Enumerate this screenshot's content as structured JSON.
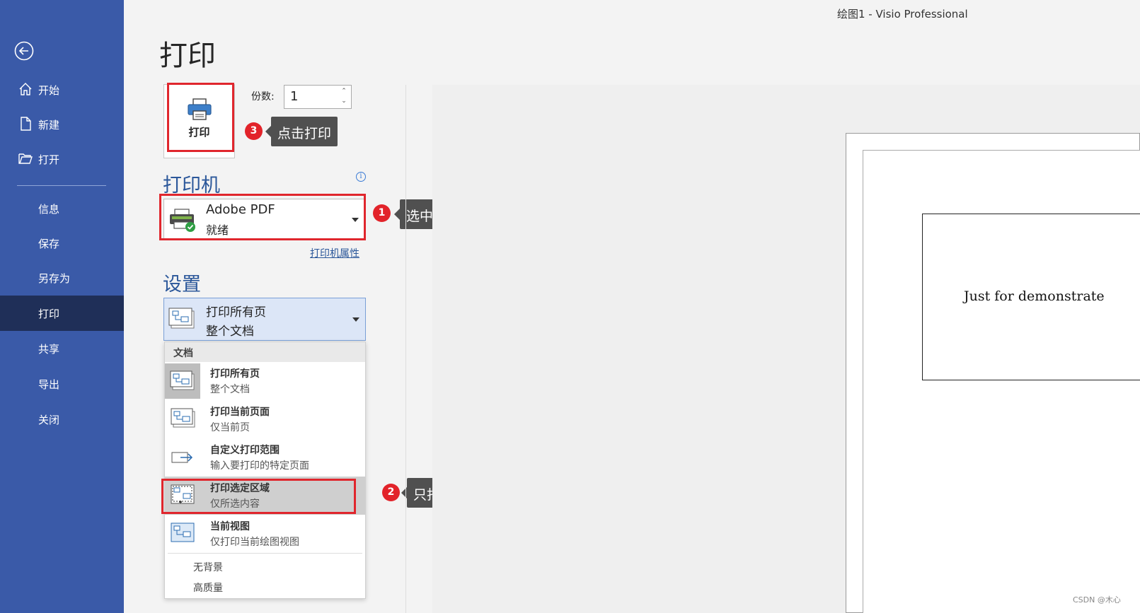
{
  "window": {
    "title": "绘图1  -  Visio Professional"
  },
  "sidebar": {
    "back_icon": "arrow-left-circle-icon",
    "items": [
      {
        "label": "开始",
        "icon": "home-icon"
      },
      {
        "label": "新建",
        "icon": "new-document-icon"
      },
      {
        "label": "打开",
        "icon": "folder-open-icon"
      },
      {
        "label": "信息"
      },
      {
        "label": "保存"
      },
      {
        "label": "另存为"
      },
      {
        "label": "打印",
        "active": true
      },
      {
        "label": "共享"
      },
      {
        "label": "导出"
      },
      {
        "label": "关闭"
      }
    ],
    "colors": {
      "background": "#3a5aa8",
      "active": "#1f2f58"
    }
  },
  "page": {
    "title": "打印"
  },
  "print_button": {
    "label": "打印",
    "icon": "printer-icon"
  },
  "copies": {
    "label": "份数:",
    "value": "1"
  },
  "printer_section": {
    "header": "打印机",
    "info_icon": "info-icon",
    "selected": {
      "name": "Adobe PDF",
      "status": "就绪",
      "icon": "printer-ready-icon"
    },
    "properties_link": "打印机属性"
  },
  "settings_section": {
    "header": "设置",
    "selected": {
      "title": "打印所有页",
      "subtitle": "整个文档"
    },
    "menu": {
      "group": "文档",
      "items": [
        {
          "title": "打印所有页",
          "subtitle": "整个文档",
          "icon": "all-pages-icon"
        },
        {
          "title": "打印当前页面",
          "subtitle": "仅当前页",
          "icon": "current-page-icon"
        },
        {
          "title": "自定义打印范围",
          "subtitle": "输入要打印的特定页面",
          "icon": "custom-range-icon"
        },
        {
          "title": "打印选定区域",
          "subtitle": "仅所选内容",
          "icon": "selection-icon",
          "selected": true
        },
        {
          "title": "当前视图",
          "subtitle": "仅打印当前绘图视图",
          "icon": "current-view-icon"
        }
      ],
      "options": [
        "无背景",
        "高质量"
      ]
    }
  },
  "callouts": [
    {
      "number": "1",
      "text": "选中Adobe虚拟打印"
    },
    {
      "number": "2",
      "text": "只打印选中区域"
    },
    {
      "number": "3",
      "text": "点击打印"
    }
  ],
  "preview": {
    "shape_text": "Just for demonstrate"
  },
  "watermark": "CSDN @木心",
  "colors": {
    "accent_red": "#e0262d",
    "badge_red": "#e2232a",
    "header_blue": "#2b579a"
  }
}
